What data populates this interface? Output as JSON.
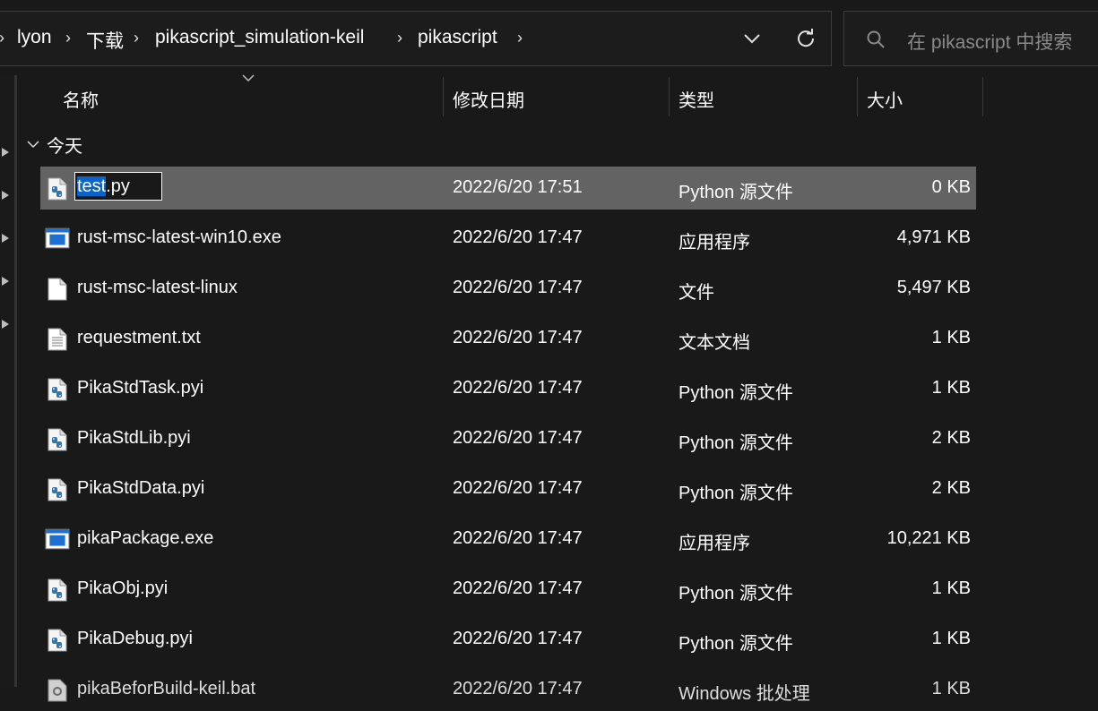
{
  "address_bar": {
    "breadcrumbs": [
      "lyon",
      "下载",
      "pikascript_simulation-keil",
      "pikascript"
    ],
    "separator": "›"
  },
  "search": {
    "placeholder": "在 pikascript 中搜索"
  },
  "columns": {
    "name": "名称",
    "date": "修改日期",
    "type": "类型",
    "size": "大小"
  },
  "group": {
    "label": "今天"
  },
  "rename": {
    "selected_part": "test",
    "rest": ".py"
  },
  "files": [
    {
      "name": "test.py",
      "date": "2022/6/20 17:51",
      "type": "Python 源文件",
      "size": "0 KB",
      "icon": "python-file-icon",
      "selected": true
    },
    {
      "name": "rust-msc-latest-win10.exe",
      "date": "2022/6/20 17:47",
      "type": "应用程序",
      "size": "4,971 KB",
      "icon": "exe-file-icon"
    },
    {
      "name": "rust-msc-latest-linux",
      "date": "2022/6/20 17:47",
      "type": "文件",
      "size": "5,497 KB",
      "icon": "blank-file-icon"
    },
    {
      "name": "requestment.txt",
      "date": "2022/6/20 17:47",
      "type": "文本文档",
      "size": "1 KB",
      "icon": "text-file-icon"
    },
    {
      "name": "PikaStdTask.pyi",
      "date": "2022/6/20 17:47",
      "type": "Python 源文件",
      "size": "1 KB",
      "icon": "python-file-icon"
    },
    {
      "name": "PikaStdLib.pyi",
      "date": "2022/6/20 17:47",
      "type": "Python 源文件",
      "size": "2 KB",
      "icon": "python-file-icon"
    },
    {
      "name": "PikaStdData.pyi",
      "date": "2022/6/20 17:47",
      "type": "Python 源文件",
      "size": "2 KB",
      "icon": "python-file-icon"
    },
    {
      "name": "pikaPackage.exe",
      "date": "2022/6/20 17:47",
      "type": "应用程序",
      "size": "10,221 KB",
      "icon": "exe-file-icon"
    },
    {
      "name": "PikaObj.pyi",
      "date": "2022/6/20 17:47",
      "type": "Python 源文件",
      "size": "1 KB",
      "icon": "python-file-icon"
    },
    {
      "name": "PikaDebug.pyi",
      "date": "2022/6/20 17:47",
      "type": "Python 源文件",
      "size": "1 KB",
      "icon": "python-file-icon"
    },
    {
      "name": "pikaBeforBuild-keil.bat",
      "date": "2022/6/20 17:47",
      "type": "Windows 批处理",
      "size": "1 KB",
      "icon": "batch-file-icon"
    }
  ]
}
